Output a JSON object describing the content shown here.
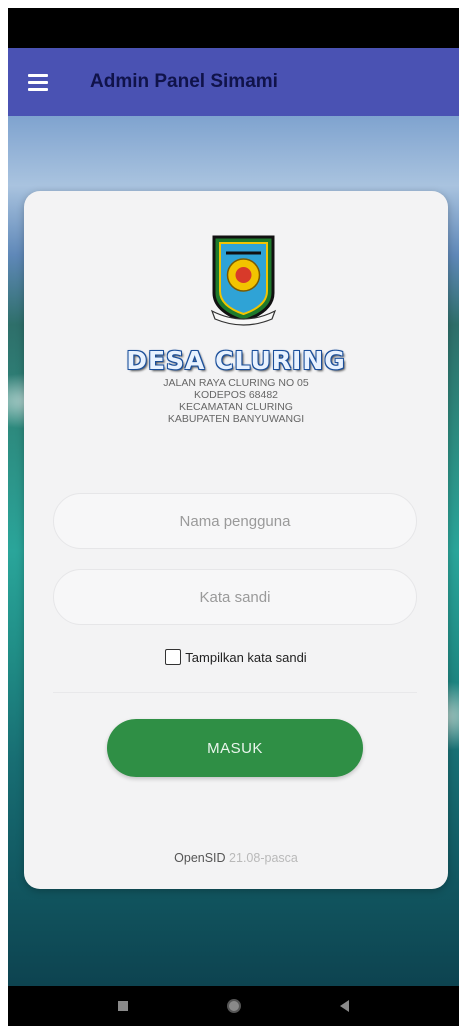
{
  "app_bar": {
    "title": "Admin Panel Simami",
    "menu_icon": "hamburger-menu-icon"
  },
  "login_card": {
    "village_name": "DESA CLURING",
    "address_lines": [
      "JALAN RAYA CLURING NO 05",
      "KODEPOS 68482",
      "KECAMATAN CLURING",
      "KABUPATEN BANYUWANGI"
    ],
    "username": {
      "placeholder": "Nama pengguna",
      "value": ""
    },
    "password": {
      "placeholder": "Kata sandi",
      "value": ""
    },
    "show_password_label": "Tampilkan kata sandi",
    "show_password_checked": false,
    "login_button": "MASUK",
    "footer": {
      "app_name": "OpenSID",
      "version": "21.08-pasca"
    }
  },
  "colors": {
    "app_bar": "#4a52b3",
    "login_button": "#2f8f45",
    "card": "#f3f3f4"
  },
  "system_nav": {
    "icons": [
      "recents-icon",
      "home-icon",
      "back-icon"
    ]
  }
}
